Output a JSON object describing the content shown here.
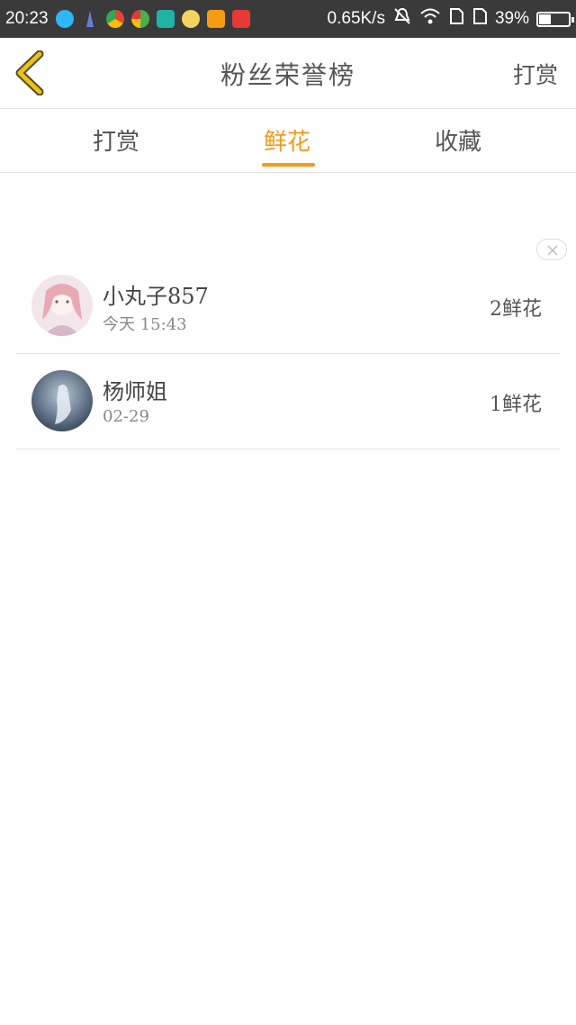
{
  "status_bar": {
    "time": "20:23",
    "network_speed": "0.65K/s",
    "battery": "39%",
    "battery_level": 0.39,
    "icons": [
      "qq-icon",
      "tower-icon",
      "chrome-icon",
      "maps-icon",
      "scan-icon",
      "emoji-icon",
      "mail-icon",
      "qiku-icon"
    ]
  },
  "header": {
    "title": "粉丝荣誉榜",
    "action": "打赏"
  },
  "tabs": [
    {
      "label": "打赏",
      "active": false
    },
    {
      "label": "鲜花",
      "active": true
    },
    {
      "label": "收藏",
      "active": false
    }
  ],
  "list": [
    {
      "name": "小丸子857",
      "time": "今天 15:43",
      "count": "2鲜花"
    },
    {
      "name": "杨师姐",
      "time": "02-29",
      "count": "1鲜花"
    }
  ],
  "colors": {
    "accent": "#f29a1b",
    "status_bar_bg": "#3a3a3a",
    "back_icon": "#e9c21d"
  }
}
